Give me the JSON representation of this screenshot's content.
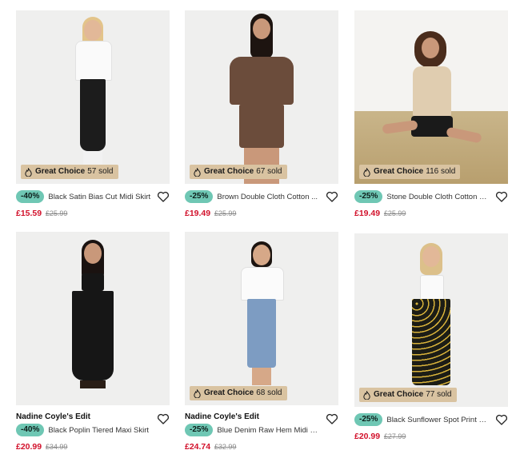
{
  "products": [
    {
      "brand": "",
      "badge_label": "Great Choice",
      "sold": "57 sold",
      "discount": "-40%",
      "name": "Black Satin Bias Cut Midi Skirt",
      "price": "£15.59",
      "was_price": "£25.99",
      "icon_badge": "flame-icon",
      "icon_fav": "heart-icon"
    },
    {
      "brand": "",
      "badge_label": "Great Choice",
      "sold": "67 sold",
      "discount": "-25%",
      "name": "Brown Double Cloth Cotton ...",
      "price": "£19.49",
      "was_price": "£25.99",
      "icon_badge": "flame-icon",
      "icon_fav": "heart-icon"
    },
    {
      "brand": "",
      "badge_label": "Great Choice",
      "sold": "116 sold",
      "discount": "-25%",
      "name": "Stone Double Cloth Cotton S...",
      "price": "£19.49",
      "was_price": "£25.99",
      "icon_badge": "flame-icon",
      "icon_fav": "heart-icon"
    },
    {
      "brand": "Nadine Coyle's Edit",
      "badge_label": "",
      "sold": "",
      "discount": "-40%",
      "name": "Black Poplin Tiered Maxi Skirt",
      "price": "£20.99",
      "was_price": "£34.99",
      "icon_badge": "",
      "icon_fav": "heart-icon"
    },
    {
      "brand": "Nadine Coyle's Edit",
      "badge_label": "Great Choice",
      "sold": "68 sold",
      "discount": "-25%",
      "name": "Blue Denim Raw Hem Midi Skirt",
      "price": "£24.74",
      "was_price": "£32.99",
      "icon_badge": "flame-icon",
      "icon_fav": "heart-icon"
    },
    {
      "brand": "",
      "badge_label": "Great Choice",
      "sold": "77 sold",
      "discount": "-25%",
      "name": "Black Sunflower Spot Print Wi...",
      "price": "£20.99",
      "was_price": "£27.99",
      "icon_badge": "flame-icon",
      "icon_fav": "heart-icon"
    }
  ],
  "colors": {
    "discount_badge": "#6fc7b4",
    "price": "#d2112b",
    "choice_badge": "#d9c3a1"
  }
}
